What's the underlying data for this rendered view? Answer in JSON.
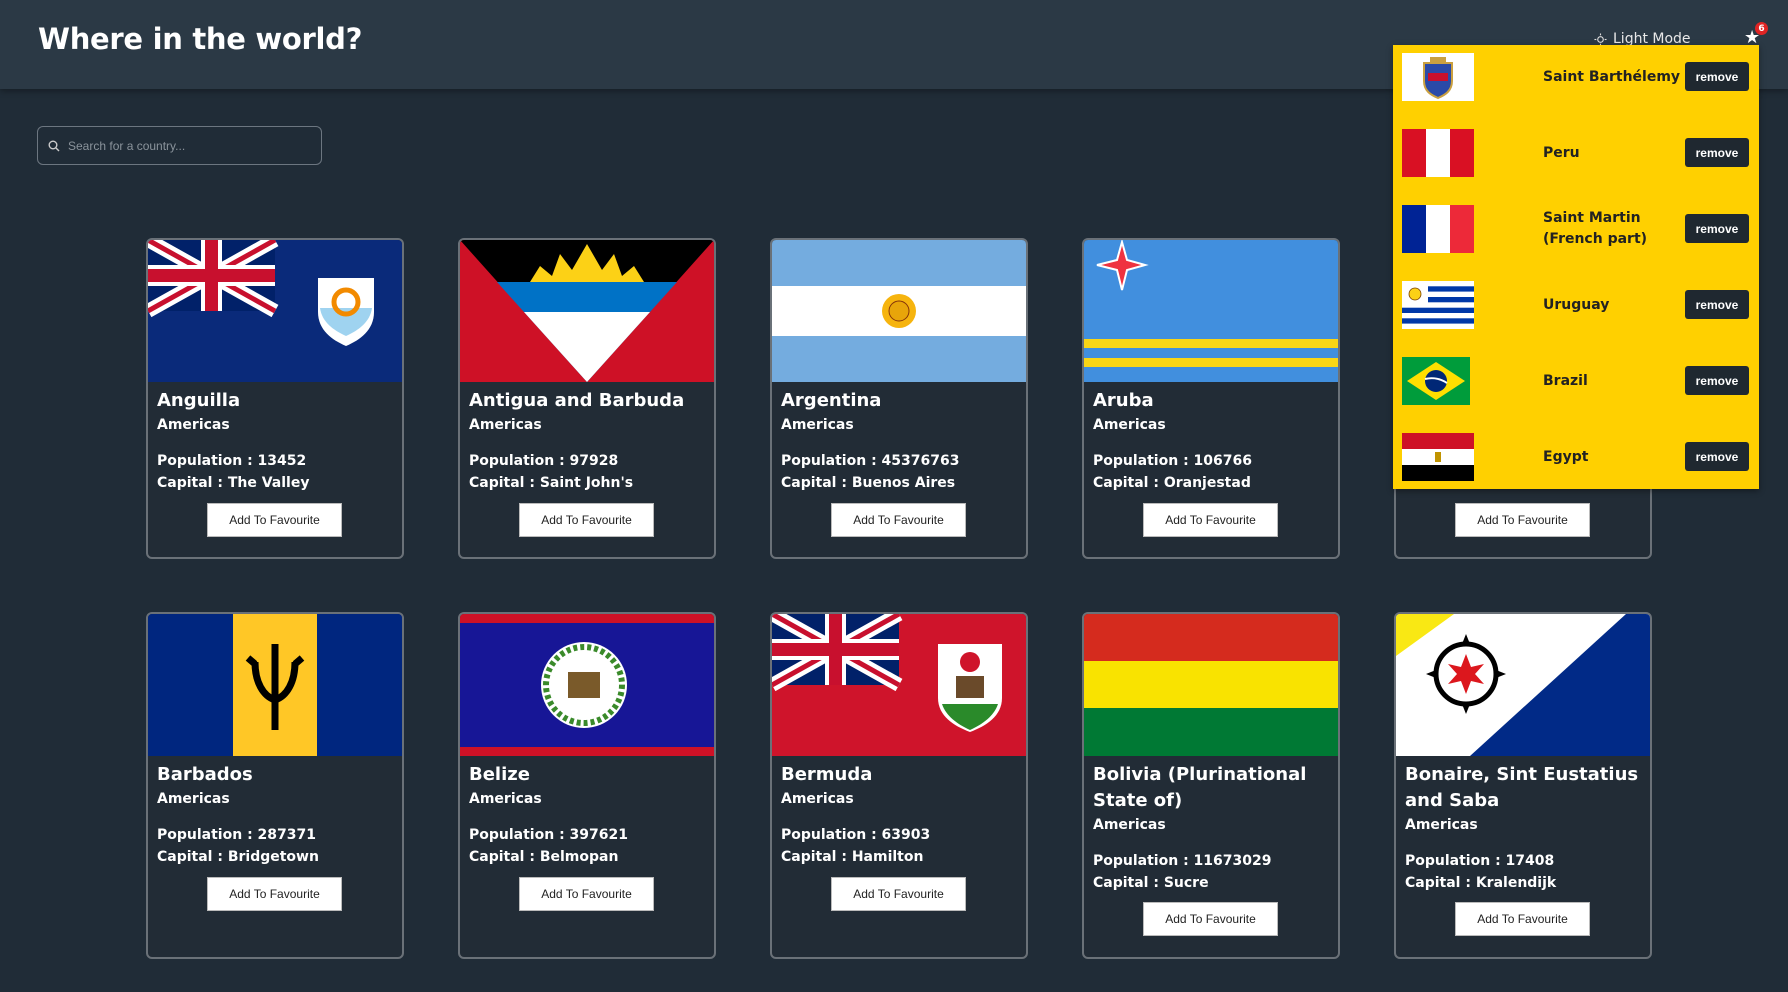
{
  "header": {
    "title": "Where in the world?",
    "mode_label": "Light Mode",
    "fav_count": "6"
  },
  "search": {
    "placeholder": "Search for a country..."
  },
  "labels": {
    "population": "Population : ",
    "capital": "Capital : ",
    "add": "Add To Favourite",
    "remove": "remove"
  },
  "countries": [
    {
      "name": "Anguilla",
      "region": "Americas",
      "population": "13452",
      "capital": "The Valley"
    },
    {
      "name": "Antigua and Barbuda",
      "region": "Americas",
      "population": "97928",
      "capital": "Saint John's"
    },
    {
      "name": "Argentina",
      "region": "Americas",
      "population": "45376763",
      "capital": "Buenos Aires"
    },
    {
      "name": "Aruba",
      "region": "Americas",
      "population": "106766",
      "capital": "Oranjestad"
    },
    {
      "name": "Barbados",
      "region": "Americas",
      "population": "287371",
      "capital": "Bridgetown"
    },
    {
      "name": "Belize",
      "region": "Americas",
      "population": "397621",
      "capital": "Belmopan"
    },
    {
      "name": "Bermuda",
      "region": "Americas",
      "population": "63903",
      "capital": "Hamilton"
    },
    {
      "name": "Bolivia (Plurinational State of)",
      "region": "Americas",
      "population": "11673029",
      "capital": "Sucre"
    },
    {
      "name": "Bonaire, Sint Eustatius and Saba",
      "region": "Americas",
      "population": "17408",
      "capital": "Kralendijk"
    }
  ],
  "favourites": [
    {
      "name": "Saint Barthélemy"
    },
    {
      "name": "Peru"
    },
    {
      "name": "Saint Martin (French part)"
    },
    {
      "name": "Uruguay"
    },
    {
      "name": "Brazil"
    },
    {
      "name": "Egypt"
    }
  ]
}
